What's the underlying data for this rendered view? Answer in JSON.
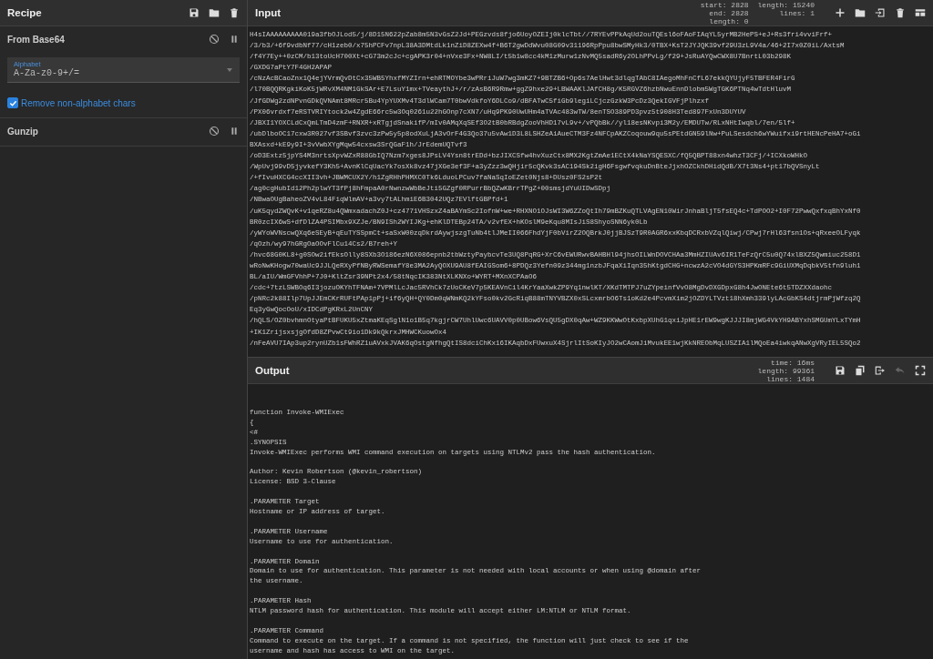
{
  "recipe": {
    "title": "Recipe",
    "operations": [
      {
        "name": "From Base64",
        "fields": [
          {
            "kind": "dropdown",
            "label": "Alphabet",
            "value": "A-Za-z0-9+/="
          },
          {
            "kind": "checkbox",
            "label": "Remove non-alphabet chars",
            "checked": true
          }
        ]
      },
      {
        "name": "Gunzip"
      }
    ]
  },
  "input": {
    "title": "Input",
    "stats": [
      [
        {
          "label": "start:",
          "value": "2828"
        },
        {
          "label": "end:",
          "value": "2828"
        },
        {
          "label": "length:",
          "value": "0"
        }
      ],
      [
        {
          "label": "length:",
          "value": "15240"
        },
        {
          "label": "lines:",
          "value": "1"
        }
      ]
    ],
    "toolbar": [
      {
        "kind": "add"
      },
      {
        "kind": "folder"
      },
      {
        "kind": "load"
      },
      {
        "kind": "delete"
      },
      {
        "kind": "layout"
      }
    ],
    "lines": [
      "H4sIAAAAAAAAA019a3fbOJLod5/j/8D15N622pZab8m5N3vGsZ2Jd+PEGzvds8fjo6UoyOZEIj0klcTbt//7RYEvPPkAqUd2ouTQEsl6oFAoFIAqYL5yrMB2HePS+eJ+Rs3fri4vviFrf+",
      "/3/b3/+6f9vdbNf77/cH1zeb0/x75hPCFv7npL38A3DMtdLk1nZiD8ZEXw4f+B6T2gwDdWvu08G09v31196RpPpu8bwSMyHk3/0TBX+KsT2JYJQK39vf29U3zL9V4a/46+2I7x0Z0iL/AxtsM",
      "/f4Y7Ey++0zCM/b13toUcH700Xt+cG73m2cJc+cgAPK3r04+nVxe3Fx+NW8LI/t5b1w8cc4kM1zMurw1zNvMQ5sadR6y2OLhPPvLg/f29+JsRuAYQwCWX8U7BnrtL03b298K",
      "/GXDG7aPtY7F4GH2APAP",
      "/cNzAcBCaoZnx1Q4ejYVrmQvDtCx35WB5YhxfMYZIrn+ehRTMOYbe3wPRriJuW7wg3mKZ7+9BTZB6+Op6s7AelHwt3dlqgTAbC8IAegoMhFnCfL67ekkQYUjyF5TBFER4FirG",
      "/l70BQQRKgkiKoK5jWRvXM4NM1GkSAr+E7LsuY1mx+TVeaythJ+/r/zAsB6R9Rmw+ggZ9hxe29+LBWAAKlJAfCH8g/K5RGVZ6hzbNwuEnnDlobm5WgTGK6PTNq4wTdtHluvM",
      "/JfGDWg2zdNPvnGDkQVNAmt8MRcr5Bu4YpYUXMv4T3dlWCam7T0bwVdkfoY6DLCo9/dBFATwC5fiGb9legiLCjczGzkW3PcDz3QekIGVFjPlhzxf",
      "/PX06vrdxf7eRSTVRIYtock2w4ZgdE66rc5w3Oq0261u22hGOnp7cXN7/uHq9PK90UwUHm4aTVAc483wTW/8enTSO389PD3pvz5t908H3Ted897FxUn3DUYUV",
      "/JBXI1YOXCLdCxQmLTmD4zmF+RNXR+xRTgjdSnakifP/mIv0AMqXqSEf3O2tB0bRBdgZooVhHD17vL9v+/vPQbBk//yl18esNKvpi3M2y/EMDUTw/RLxNHtIwqbl/7en/5lf+",
      "/ubDlboOC17cxw3R027vf3SBvf3zvc3zPw5y5p8odXuLjA3vOrF4G3Qo37u5vAw1D3L8LSHZeAiAueCTM3Fz4NFCpAKZCoqouw9qu5sPEtdGN59lNw+PuLSesdch6wYWuifxi9rtHENcPeHA7+oGi",
      "BXAsxd+kE9y9I+3vVwbXYgMqw54cxsw3SrQGaF1h/JrEdemUQTvf3",
      "/oD3Extz5jpYS4M3nrtsXpvWZxR88GbIQ7Nzm7xges8JPsLV4Ysn8trEDd+bzJIXCSfw4hvXuzCtx8MX2KgtZmAe1ECtX4kNaYSQESXC/fQ5QBPT88xn4whzT3CFj/+ICXkoWHkO",
      "/WpUvj99vD5jyvkefY3Kh5+AvnKlCqUacYk7osXk8vz47jXGe3ef3F+a3yZzz3wQHjir5cQKvk3sAC194Sk2igH6FsgwfvqkuDnBteJjxhOZCkhDHidQdB/X7t3Ns4+pt17bQVSnyLt",
      "/+fIvuHXCG4ccXII3vh+JBWMCUX2Y/h1ZgRHhPHMXC0Tk6LduoLPCuv7faNaSqIoEZet0Njs8+DUsz0FS2sP2t",
      "/ag0cgHubId12Ph2plwYT3fPj8hFmpaA0rNwnzwWbBeJti5GZgf0RPurrBbQZwKBrrTPgZ+00smsjdYuUIDwSDpj",
      "/NBwaOUgBaheoZV4vL84FiqWlmAV+a3vy7tALhmiE6B3042UQz7EVlftGBPfd+1",
      "/uK5qydZWQvK+v1qeRZ8u4QWmxadachZ0J+cz4771VHSzxZ4aBAYmSc2IofnW+we+RHXNO1OJsWI3W6ZZoQtIh79mBZKuQTLVAgEN10WirJnhaBljT5fsEQ4c+TdPOO2+I0F72PwwQxfxqBhYxNf0",
      "BR0zcIX6wS+dfDlZA4PSIMbx9XZJe/BN9ISh2WYIJKg+ehKlDTEBp24TA/v2vfEX+hKOslM9eKqu8MIsJiS8ShyoSNN6yk0Lb",
      "/yWYoWVNscwQXq6eSEyB+qEuTYSSpmCt+saSxW00zqDkrdAywjszgTuNb4tlJMeII066FhdYjF0bVirZ2OQBrkJ0jjBJSzT9R0AGR6xxKbqDCRxbVZqlQiwj/CPwj7rHl63fsn1Os+qRxeeOLFyqk",
      "/qOzh/wy97hGRgOaOOvFlCu14Cs2/B7reh+Y",
      "/hvc68G0KL8+g0SOw2ifEksOlly8SXb3O186ezN6X086epnb2tbWztyPaybcvTe3UQ8PqRG+XrC6vEWURwvBAHBHl94jhsOILWnDOVCHAa3MmHZIUAv6IR1TeFzQrC5u0Q74xlBXZ5Qwmiuc258D1",
      "wRoNwKHogw70waUc9JJLQeRXyPfNByRWSemafY8e3MA2AyQOXU9AU8fEAIGSom6+8PDQz3Yefn09z344mg1nzbJFqaXiIqn35hKtgdCHG+ncwzA2cVO4dGYS3HPKmRFc9GiUXMqDqbkV5tfn9luh1",
      "BL/aIU/WmGFVhhP+7J0+KltZsr39NPt2x4/58tNqcIK383NtXLKNXo+WYRT+MXnXCPAaO6",
      "/cdc+7tzLSWBOq6I3jozuOKYhTFNAm+7VPMlLcJac5RVhCk7zUoCKeV7p5KEAVnCil4KrYaaXwkZP9Yq1nwlKT/XKdTMTPJ7uZYpeinfVvO8MgDvDXGDpxG8h4JwONEte6t5TDZXXdaohc",
      "/pNRc2k88Ilp7UpJJEmCKrRUFtPAp1pPj+if6yQH+QY0Dm0qWNmKQ2kYFso0kv2GcRiqB88mTNYVBZX0xSLcxmrbO6Ts1oKd2e4PcvmXim2jOZDYLTVzt18hXmh339lyLAcGbKS4dtjrmPjWfzq2Q",
      "Eq3yGwQocOoU/xIDCdPgKRxL2UnCNY",
      "/hQLS/OZ0bvhmnOtyaPtBFUKU5xZtmaKEqSglN1o1B5q7kgjrCW7UhlUwc6UAVV0p0UBow6VsQU5gDX0qAw+WZ9KKWwOtKxbpXUhG1qxiJpHE1rEW9wgKJJJI8mjWG4VkYH9ABYxhSMGUmYLxTYmH",
      "+IK1ZrijsxsjgOfdD8ZPvwCt9io1Dk9kQkrxJMHWCKuowOx4",
      "/nFeAVU7IAp3up2rynUZb1sFWhRZ1uAVxkJVAK6qOstgNfhgQtIS8dciChKx16IKAqbDxFUwxuX4SjrlItSoKIyJO2wCAomJiMvukEE1wjKkNREObMqLUSZIA1lMQoEa4iwkqANwXgVRyIEL5SQo2"
    ]
  },
  "output": {
    "title": "Output",
    "stats": [
      [
        {
          "label": "time:",
          "value": "16ms"
        },
        {
          "label": "length:",
          "value": "99361"
        },
        {
          "label": "lines:",
          "value": "1484"
        }
      ]
    ],
    "toolbar": [
      {
        "kind": "save",
        "disabled": false
      },
      {
        "kind": "copy",
        "disabled": false
      },
      {
        "kind": "replace",
        "disabled": false
      },
      {
        "kind": "undo",
        "disabled": true
      },
      {
        "kind": "fullscreen",
        "disabled": false
      }
    ],
    "paragraphs": [
      [
        "function Invoke-WMIExec",
        "{",
        "<#",
        ".SYNOPSIS",
        "Invoke-WMIExec performs WMI command execution on targets using NTLMv2 pass the hash authentication."
      ],
      [
        "Author: Kevin Robertson (@kevin_robertson)",
        "License: BSD 3-Clause"
      ],
      [
        ".PARAMETER Target",
        "Hostname or IP address of target."
      ],
      [
        ".PARAMETER Username",
        "Username to use for authentication."
      ],
      [
        ".PARAMETER Domain",
        "Domain to use for authentication. This parameter is not needed with local accounts or when using @domain after",
        "the username."
      ],
      [
        ".PARAMETER Hash",
        "NTLM password hash for authentication. This module will accept either LM:NTLM or NTLM format."
      ],
      [
        ".PARAMETER Command",
        "Command to execute on the target. If a command is not specified, the function will just check to see if the",
        "username and hash has access to WMI on the target."
      ]
    ]
  }
}
